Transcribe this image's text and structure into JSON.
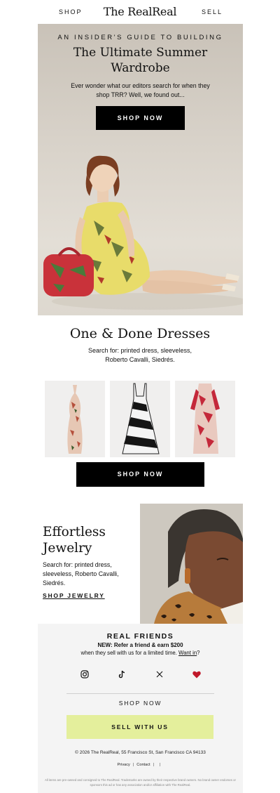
{
  "nav": {
    "left": "SHOP",
    "logo": "The RealReal",
    "right": "SELL"
  },
  "hero": {
    "eyebrow": "AN INSIDER'S GUIDE TO BUILDING",
    "title_line1": "The Ultimate Summer",
    "title_line2": "Wardrobe",
    "subtitle": "Ever wonder what our editors search for when they shop TRR? Well, we found out...",
    "cta": "SHOP NOW"
  },
  "dresses": {
    "title": "One & Done Dresses",
    "subtitle": "Search for: printed dress, sleeveless, Roberto Cavalli, Siedrés.",
    "cta": "SHOP NOW"
  },
  "jewelry": {
    "title_line1": "Effortless",
    "title_line2": "Jewelry",
    "subtitle": "Search for: printed dress, sleeveless, Roberto Cavalli, Siedrés.",
    "cta": "SHOP JEWELRY"
  },
  "footer": {
    "real_friends_title": "REAL FRIENDS",
    "refer_line": "NEW: Refer a friend & earn $200",
    "refer_sub": "when they sell with us for a limited time.",
    "want_in": "Want in",
    "want_in_suffix": "?",
    "shop_now": "SHOP NOW",
    "sell_with_us": "SELL WITH US",
    "copyright": "© 2026 The RealReal, 55 Francisco St, San Francisco CA 94133",
    "privacy": "Privacy",
    "contact": "Contact",
    "sep": "|",
    "legal": "All items are pre-owned and consigned to The RealReal. Trademarks are owned by their respective brand owners. No brand owner endorses or sponsors this ad or has any association and/or affiliation with The RealReal."
  },
  "colors": {
    "black": "#000000",
    "sell_button": "#e4ef9c",
    "heart": "#c0182a",
    "footer_bg": "#f4f4f4"
  },
  "icons": [
    "instagram-icon",
    "tiktok-icon",
    "x-icon",
    "heart-icon"
  ]
}
